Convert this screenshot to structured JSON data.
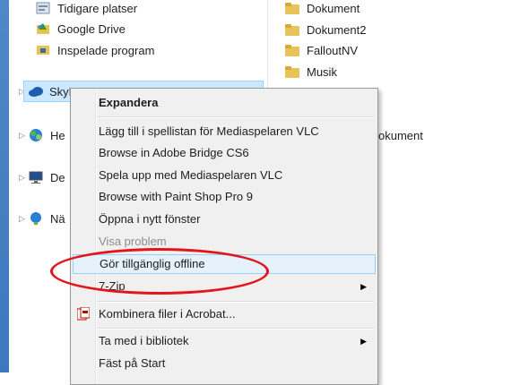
{
  "nav": {
    "items": [
      {
        "label": "Tidigare platser",
        "icon": "recent-places-icon"
      },
      {
        "label": "Google Drive",
        "icon": "google-drive-icon"
      },
      {
        "label": "Inspelade program",
        "icon": "recorded-tv-icon"
      },
      {
        "label": "SkyD",
        "icon": "skydrive-cloud-icon"
      },
      {
        "label": "He",
        "icon": "homegroup-icon"
      },
      {
        "label": "De",
        "icon": "computer-icon"
      },
      {
        "label": "Nä",
        "icon": "network-icon"
      }
    ]
  },
  "files": {
    "items": [
      {
        "label": "Dokument"
      },
      {
        "label": "Dokument2"
      },
      {
        "label": "FalloutNV"
      },
      {
        "label": "Musik"
      },
      {
        "label": "okument"
      }
    ]
  },
  "context_menu": {
    "items": [
      {
        "label": "Expandera",
        "style": "bold"
      },
      {
        "label": "Lägg till i spellistan för Mediaspelaren VLC"
      },
      {
        "label": "Browse in Adobe Bridge CS6"
      },
      {
        "label": "Spela upp med Mediaspelaren VLC"
      },
      {
        "label": "Browse with Paint Shop Pro 9"
      },
      {
        "label": "Öppna i nytt fönster"
      },
      {
        "label": "Visa problem",
        "state": "disabled"
      },
      {
        "label": "Gör tillgänglig offline",
        "state": "highlighted"
      },
      {
        "label": "7-Zip",
        "submenu": true
      },
      {
        "label": "Kombinera filer i Acrobat...",
        "icon": "acrobat-combine-icon"
      },
      {
        "label": "Ta med i bibliotek",
        "submenu": true
      },
      {
        "label": "Fäst på Start"
      }
    ]
  },
  "colors": {
    "highlight_ellipse": "#e3141b",
    "hot_item_bg": "#e5f1fb",
    "left_strip": "#3d78bd"
  }
}
